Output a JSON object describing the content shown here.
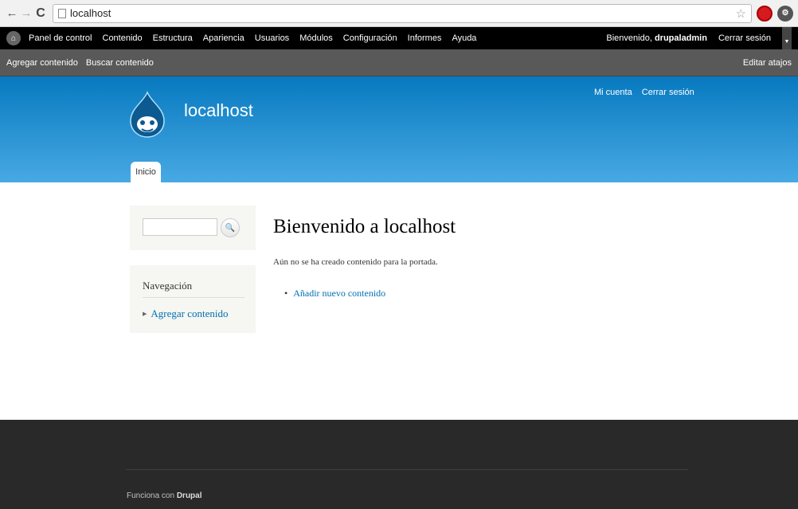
{
  "browser": {
    "url": "localhost"
  },
  "toolbar": {
    "menu": [
      "Panel de control",
      "Contenido",
      "Estructura",
      "Apariencia",
      "Usuarios",
      "Módulos",
      "Configuración",
      "Informes",
      "Ayuda"
    ],
    "welcome_prefix": "Bienvenido, ",
    "username": "drupaladmin",
    "logout": "Cerrar sesión"
  },
  "shortcuts": {
    "items": [
      "Agregar contenido",
      "Buscar contenido"
    ],
    "edit": "Editar atajos"
  },
  "header": {
    "site_name": "localhost",
    "secondary_menu": [
      "Mi cuenta",
      "Cerrar sesión"
    ],
    "main_tab": "Inicio"
  },
  "sidebar": {
    "nav_title": "Navegación",
    "nav_link": "Agregar contenido"
  },
  "main": {
    "title": "Bienvenido a localhost",
    "intro": "Aún no se ha creado contenido para la portada.",
    "add_link": "Añadir nuevo contenido"
  },
  "footer": {
    "powered_prefix": "Funciona con ",
    "powered_name": "Drupal"
  }
}
